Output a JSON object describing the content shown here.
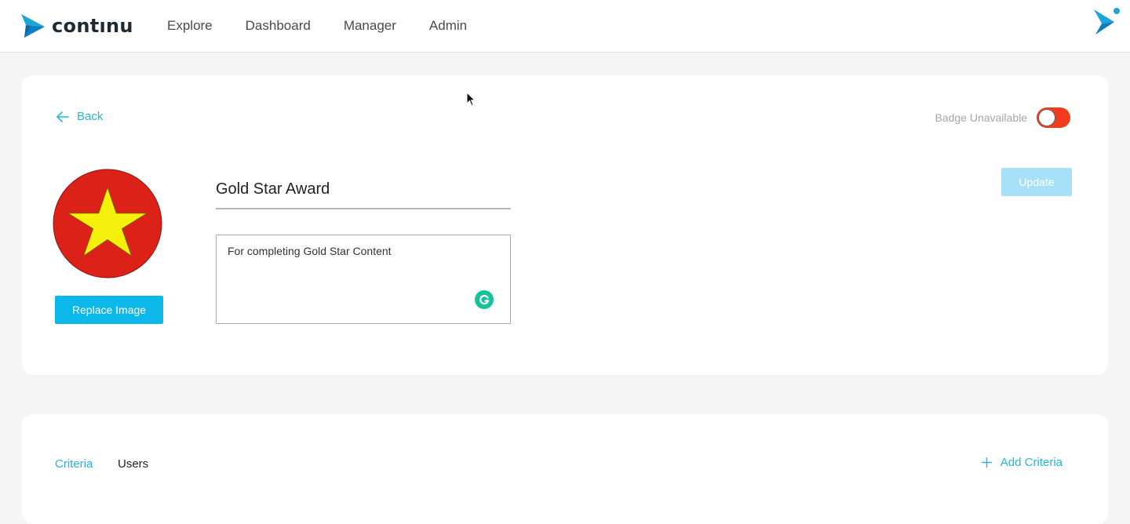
{
  "header": {
    "brand_name": "contınu",
    "nav": [
      "Explore",
      "Dashboard",
      "Manager",
      "Admin"
    ]
  },
  "badge": {
    "back_label": "Back",
    "availability_label": "Badge Unavailable",
    "availability_on": false,
    "name": "Gold Star Award",
    "description": "For completing Gold Star Content",
    "replace_image_label": "Replace Image",
    "update_label": "Update"
  },
  "tabs": {
    "criteria": "Criteria",
    "users": "Users",
    "active": "Criteria"
  },
  "add_criteria_label": "Add Criteria",
  "colors": {
    "accent": "#25b6d9",
    "primary_button": "#0cb7ea",
    "disabled_button": "#a7e1f7",
    "toggle_off": "#f13b1c",
    "badge_red": "#dc2119",
    "badge_star": "#f4ef0b",
    "grammarly": "#15c39a"
  },
  "icons": {
    "brand": "continu-logo-icon",
    "back": "arrow-left-icon",
    "add": "plus-icon",
    "grammarly": "grammarly-icon",
    "corner": "continu-mark-icon"
  }
}
